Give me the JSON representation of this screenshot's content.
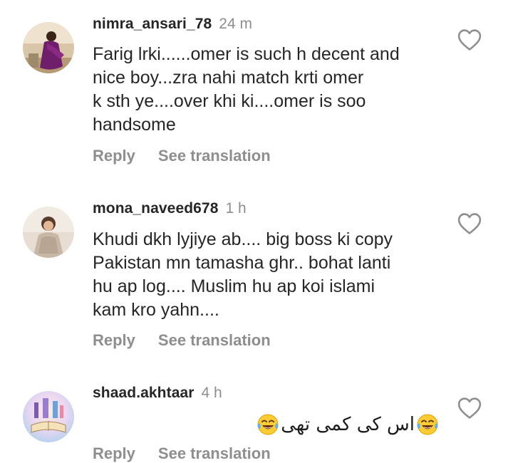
{
  "comments": [
    {
      "username": "nimra_ansari_78",
      "time": "24 m",
      "lines": [
        "Farig lrki......omer is such h decent and",
        "nice boy...zra nahi match krti omer",
        "k sth ye....over khi ki....omer is soo",
        "handsome"
      ],
      "reply_label": "Reply",
      "translate_label": "See translation"
    },
    {
      "username": "mona_naveed678",
      "time": "1 h",
      "lines": [
        "Khudi dkh lyjiye ab.... big boss ki copy",
        "Pakistan mn tamasha ghr.. bohat lanti",
        "hu ap log.... Muslim hu ap koi islami",
        "kam kro yahn...."
      ],
      "reply_label": "Reply",
      "translate_label": "See translation"
    },
    {
      "username": "shaad.akhtaar",
      "time": "4 h",
      "text": "اس کی کمی تھی",
      "reply_label": "Reply",
      "translate_label": "See translation"
    }
  ],
  "icons": {
    "like": "heart-outline-icon",
    "emoji": "face-with-tears-of-joy-emoji"
  },
  "colors": {
    "username": "#262626",
    "meta": "#8e8e8e",
    "text": "#262626"
  }
}
